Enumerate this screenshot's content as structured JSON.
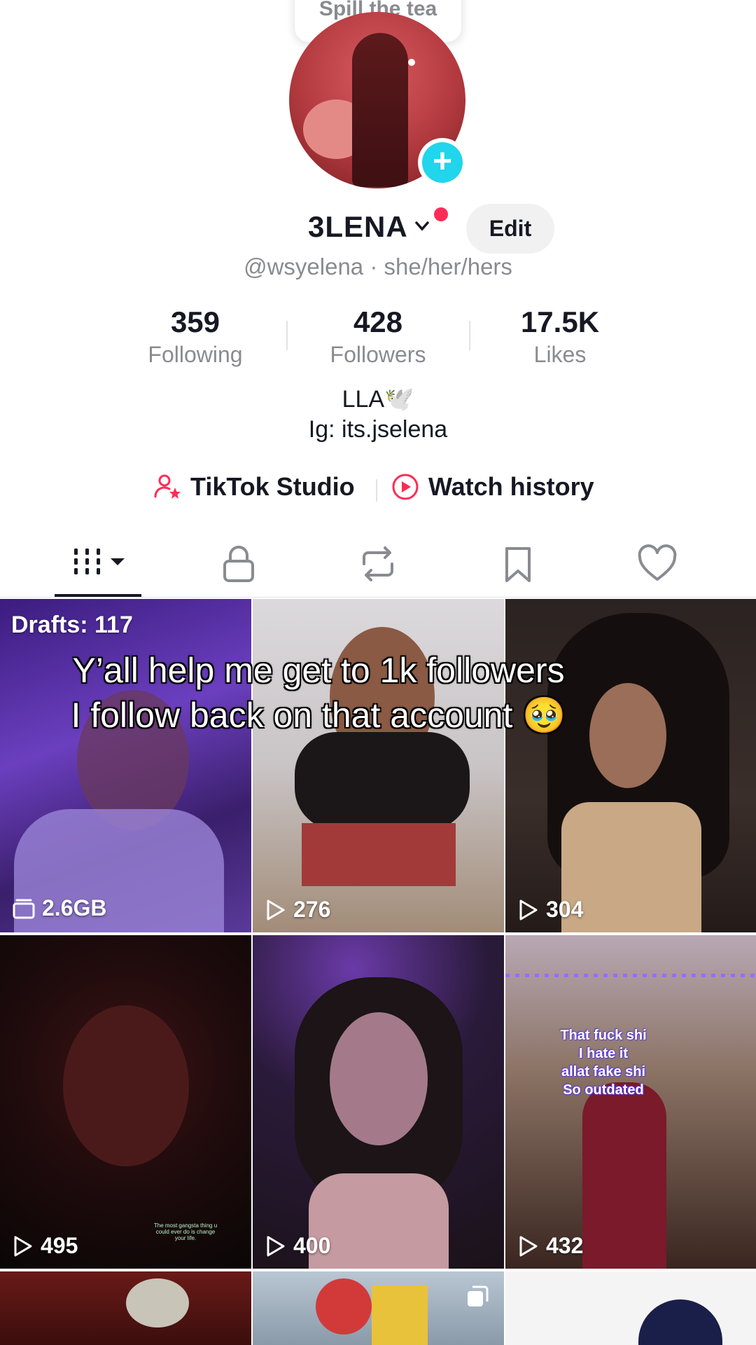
{
  "tooltip": {
    "text": "Spill the tea"
  },
  "profile": {
    "display_name": "3LENA",
    "edit_label": "Edit",
    "handle_line": "@wsyelena · she/her/hers",
    "bio_line1": "LLA🕊️",
    "bio_line2": "Ig: its.jselena"
  },
  "stats": [
    {
      "value": "359",
      "label": "Following"
    },
    {
      "value": "428",
      "label": "Followers"
    },
    {
      "value": "17.5K",
      "label": "Likes"
    }
  ],
  "links": {
    "studio": "TikTok Studio",
    "history": "Watch history"
  },
  "tabs": [
    "videos-icon",
    "lock-icon",
    "repost-icon",
    "bookmark-icon",
    "heart-icon"
  ],
  "grid": {
    "drafts_label": "Drafts: 117",
    "drafts_size": "2.6GB",
    "overlay_caption": "Y’all help me get to 1k followers I follow back on that account 🥹",
    "tile6_caption": "That fuck shi\nI hate it\nallat fake shi\nSo outdated",
    "tile4_caption": "The most gangsta thing u could ever do is change your life.",
    "counts": [
      "276",
      "304",
      "495",
      "400",
      "432"
    ]
  },
  "colors": {
    "accent_pink": "#fe2c55",
    "add_badge": "#20d5ec",
    "muted_text": "#8a8b91"
  }
}
